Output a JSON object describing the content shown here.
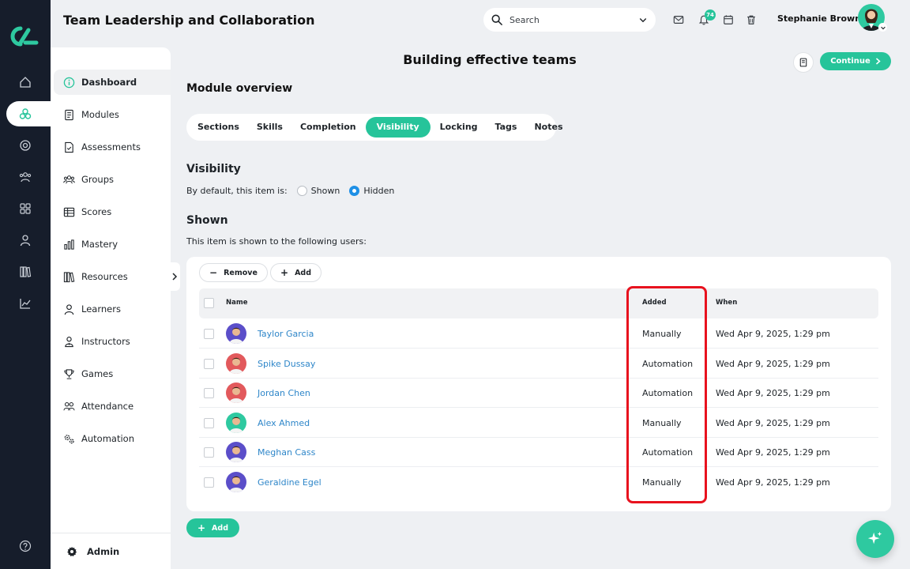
{
  "app": {
    "title": "Team Leadership and Collaboration"
  },
  "header": {
    "search_placeholder": "Search",
    "notification_count": "74",
    "user_name": "Stephanie Brown",
    "icons": [
      "mail-icon",
      "bell-icon",
      "calendar-icon",
      "trash-icon"
    ]
  },
  "rail": {
    "icons": [
      "home-icon",
      "modules-cluster-icon",
      "target-icon",
      "people-icon",
      "apps-grid-icon",
      "user-icon",
      "library-icon",
      "chart-icon",
      "help-icon"
    ]
  },
  "sidebar": {
    "items": [
      {
        "label": "Dashboard",
        "icon": "info-icon",
        "active": true
      },
      {
        "label": "Modules",
        "icon": "book-icon"
      },
      {
        "label": "Assessments",
        "icon": "document-icon"
      },
      {
        "label": "Groups",
        "icon": "group-icon"
      },
      {
        "label": "Scores",
        "icon": "table-icon"
      },
      {
        "label": "Mastery",
        "icon": "bar-chart-icon"
      },
      {
        "label": "Resources",
        "icon": "books-icon"
      },
      {
        "label": "Learners",
        "icon": "person-icon"
      },
      {
        "label": "Instructors",
        "icon": "instructor-icon"
      },
      {
        "label": "Games",
        "icon": "trophy-icon"
      },
      {
        "label": "Attendance",
        "icon": "attendance-icon"
      },
      {
        "label": "Automation",
        "icon": "gears-icon"
      }
    ],
    "admin_label": "Admin"
  },
  "main": {
    "page_title": "Building effective teams",
    "continue_label": "Continue",
    "overview_heading": "Module overview",
    "tabs": [
      {
        "label": "Sections"
      },
      {
        "label": "Skills"
      },
      {
        "label": "Completion"
      },
      {
        "label": "Visibility",
        "active": true
      },
      {
        "label": "Locking"
      },
      {
        "label": "Tags"
      },
      {
        "label": "Notes"
      }
    ],
    "visibility": {
      "heading": "Visibility",
      "default_label": "By default, this item is:",
      "options": [
        "Shown",
        "Hidden"
      ],
      "selected": "Hidden"
    },
    "shown": {
      "heading": "Shown",
      "description": "This item is shown to the following users:",
      "remove_label": "Remove",
      "add_label": "Add",
      "columns": {
        "name": "Name",
        "added": "Added",
        "when": "When"
      },
      "rows": [
        {
          "name": "Taylor Garcia",
          "added": "Manually",
          "when": "Wed Apr 9, 2025, 1:29 pm",
          "avatar_color": "#5b4ec9"
        },
        {
          "name": "Spike Dussay",
          "added": "Automation",
          "when": "Wed Apr 9, 2025, 1:29 pm",
          "avatar_color": "#e2595c"
        },
        {
          "name": "Jordan Chen",
          "added": "Automation",
          "when": "Wed Apr 9, 2025, 1:29 pm",
          "avatar_color": "#e2595c"
        },
        {
          "name": "Alex Ahmed",
          "added": "Manually",
          "when": "Wed Apr 9, 2025, 1:29 pm",
          "avatar_color": "#2ec9a0"
        },
        {
          "name": "Meghan Cass",
          "added": "Automation",
          "when": "Wed Apr 9, 2025, 1:29 pm",
          "avatar_color": "#5b4ec9"
        },
        {
          "name": "Geraldine Egel",
          "added": "Manually",
          "when": "Wed Apr 9, 2025, 1:29 pm",
          "avatar_color": "#5b4ec9"
        }
      ]
    },
    "bottom_add_label": "Add"
  },
  "colors": {
    "accent": "#26c49a",
    "rail_bg": "#161d2b",
    "link": "#2e86c9",
    "highlight": "#e8121e",
    "radio_selected": "#1e90e6"
  }
}
